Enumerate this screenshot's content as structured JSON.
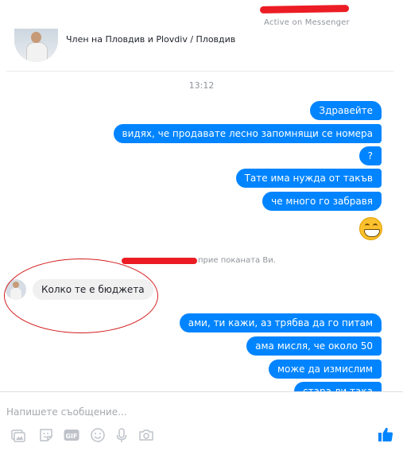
{
  "header": {
    "contact_name": "",
    "status": "Active on Messenger",
    "member_info": "Член на Пловдив и Plovdiv / Пловдив"
  },
  "conversation": {
    "timestamp": "13:12",
    "outgoing_group_1": [
      "Здравейте",
      "видях, че продавате лесно запомнящи се номера",
      "?",
      "Тате има нужда от такъв",
      "че много го забравя"
    ],
    "emoji": "grinning-face-emoji",
    "notice_text": "прие поканата Ви.",
    "incoming": "Колко те е бюджета",
    "outgoing_group_2": [
      "ами, ти кажи, аз трябва да го питам",
      "ама мисля, че около 50",
      "може да измислим",
      "стара ли така"
    ]
  },
  "composer": {
    "placeholder": "Напишете съобщение...",
    "tools": [
      "image-icon",
      "sticker-icon",
      "gif-icon",
      "emoji-icon",
      "microphone-icon",
      "camera-icon"
    ],
    "send_icon": "like-icon"
  },
  "colors": {
    "accent": "#0084ff",
    "bubble_incoming": "#f1f0f0",
    "annotation_red": "#d41c1c"
  }
}
